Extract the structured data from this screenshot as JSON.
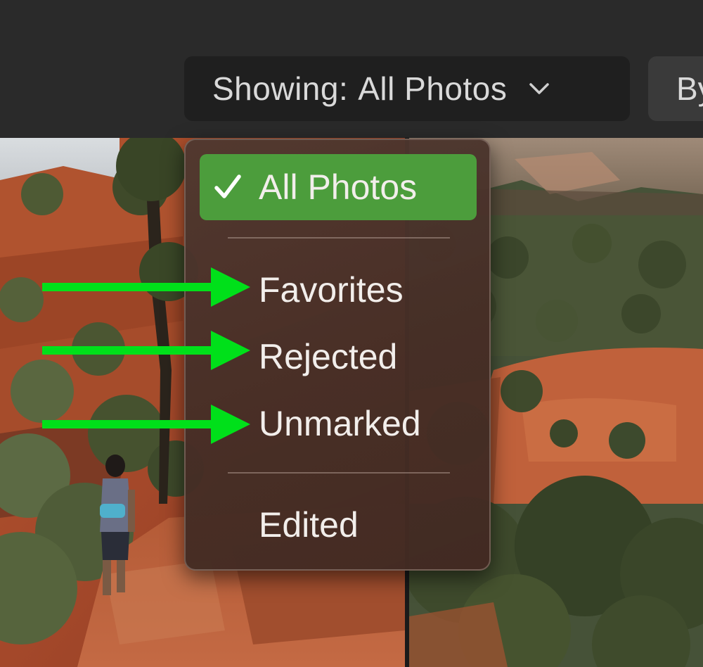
{
  "toolbar": {
    "showing_prefix": "Showing:",
    "showing_value": "All Photos",
    "next_button_label": "By"
  },
  "menu": {
    "items": [
      {
        "label": "All Photos",
        "selected": true
      },
      {
        "label": "Favorites",
        "selected": false
      },
      {
        "label": "Rejected",
        "selected": false
      },
      {
        "label": "Unmarked",
        "selected": false
      },
      {
        "label": "Edited",
        "selected": false
      }
    ]
  },
  "colors": {
    "selection_accent": "#4c9d3c",
    "annotation_arrow": "#00e01a"
  }
}
